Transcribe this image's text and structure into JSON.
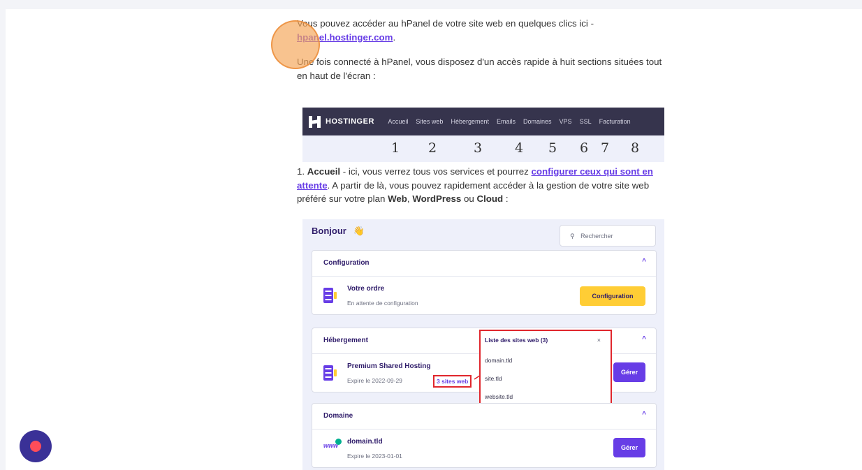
{
  "intro": {
    "text": "Vous pouvez accéder au hPanel de votre site web en quelques clics ici -",
    "link": "hpanel.hostinger.com",
    "after_link": "."
  },
  "sections_intro": "Une fois connecté à hPanel, vous disposez d'un accès rapide à huit sections situées tout en haut de l'écran :",
  "navbar": {
    "brand": "HOSTINGER",
    "items": [
      "Accueil",
      "Sites web",
      "Hébergement",
      "Emails",
      "Domaines",
      "VPS",
      "SSL",
      "Facturation"
    ],
    "numbers": [
      "1",
      "2",
      "3",
      "4",
      "5",
      "6",
      "7",
      "8"
    ]
  },
  "accueil": {
    "prefix": "1. ",
    "title": "Accueil",
    "text1": " - ici, vous verrez tous vos services et pourrez ",
    "link": "configurer ceux qui sont en attente",
    "text2": ". A partir de là, vous pouvez rapidement accéder à la gestion de votre site web préféré sur votre plan ",
    "plan_web": "Web",
    "sep1": ", ",
    "plan_wp": "WordPress",
    "sep2": " ou ",
    "plan_cloud": "Cloud",
    "end": " :"
  },
  "dashboard": {
    "greeting": "Bonjour",
    "wave_emoji": "👋",
    "search_placeholder": "Rechercher",
    "configuration": {
      "header": "Configuration",
      "title": "Votre ordre",
      "subtitle": "En attente de configuration",
      "button": "Configuration"
    },
    "hebergement": {
      "header": "Hébergement",
      "title": "Premium Shared Hosting",
      "subtitle": "Expire le 2022-09-29",
      "sites_link": "3 sites web",
      "button": "Gérer"
    },
    "domaine": {
      "header": "Domaine",
      "icon_text": "www",
      "title": "domain.tld",
      "subtitle": "Expire le 2023-01-01",
      "button": "Gérer"
    },
    "popup": {
      "title": "Liste des sites web (3)",
      "close": "×",
      "items": [
        "domain.tld",
        "site.tld",
        "website.tld"
      ]
    },
    "chevron": "^",
    "search_icon": "search-icon"
  },
  "colors": {
    "accent": "#673de6",
    "navbar": "#36344d",
    "highlight": "#e0262d",
    "yellow": "#ffcd35",
    "fab": "#3a3197"
  }
}
